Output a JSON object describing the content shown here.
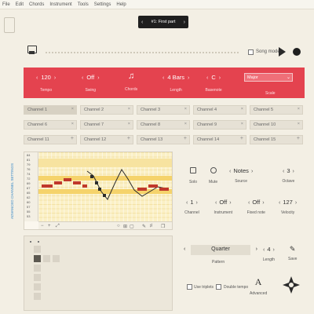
{
  "menu": [
    "File",
    "Edit",
    "Chords",
    "Instrument",
    "Tools",
    "Settings",
    "Help"
  ],
  "part": {
    "prev": "‹",
    "name": "#1: First part",
    "next": "›"
  },
  "transport": {
    "song_mode_label": "Song mode"
  },
  "global": {
    "tempo": {
      "value": "120",
      "label": "Tempo"
    },
    "swing": {
      "value": "Off",
      "label": "Swing"
    },
    "chords": {
      "label": "Chords",
      "icon": "music-note-icon"
    },
    "length": {
      "value": "4 Bars",
      "label": "Length"
    },
    "basenote": {
      "value": "C",
      "label": "Basenote"
    },
    "scale": {
      "value": "Major",
      "label": "Scale"
    }
  },
  "channels": [
    "Channel 1",
    "Channel 2",
    "Channel 3",
    "Channel 4",
    "Channel 5",
    "Channel 6",
    "Channel 7",
    "Channel 8",
    "Channel 9",
    "Channel 10",
    "Channel 11",
    "Channel 12",
    "Channel 13",
    "Channel 14",
    "Channel 15"
  ],
  "side_label": "ADVANCED CHANNEL SETTINGS",
  "roll_keys": [
    "84",
    "81",
    "79",
    "76",
    "74",
    "72",
    "69",
    "67",
    "65",
    "62",
    "60",
    "57",
    "55",
    "53",
    "50"
  ],
  "controls": {
    "solo": "Solo",
    "mute": "Mute",
    "source": {
      "value": "Notes",
      "label": "Source"
    },
    "octave": {
      "value": "3",
      "label": "Octave"
    },
    "channel": {
      "value": "1",
      "label": "Channel"
    },
    "instrument": {
      "value": "Off",
      "label": "Instrument"
    },
    "fixed_note": {
      "value": "Off",
      "label": "Fixed note"
    },
    "velocity": {
      "value": "127",
      "label": "Velocity"
    },
    "pattern": {
      "value": "Quarter",
      "label": "Pattern"
    },
    "plength": {
      "value": "4",
      "label": "Length"
    },
    "save": "Save",
    "use_triplets": "Use triplets",
    "double_tempo": "Double tempo",
    "advanced": {
      "glyph": "A",
      "label": "Advanced"
    }
  },
  "colors": {
    "accent_red": "#e4434f",
    "note_red": "#c0392b",
    "grid_yellow": "#fbf0c5",
    "background": "#f3efe4"
  }
}
